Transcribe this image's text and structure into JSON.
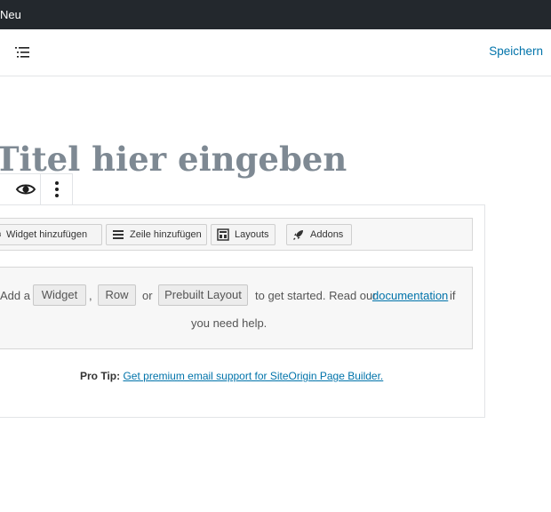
{
  "admin_bar": {
    "new_label": "Neu"
  },
  "header": {
    "save_label": "Speichern"
  },
  "title": {
    "placeholder": "Titel hier eingeben"
  },
  "pb_toolbar": {
    "widget": "Widget hinzufügen",
    "row": "Zeile hinzufügen",
    "layouts": "Layouts",
    "addons": "Addons"
  },
  "empty_state": {
    "add_a": "Add a",
    "widget_btn": "Widget",
    "comma": ",",
    "row_btn": "Row",
    "or": "or",
    "prebuilt_btn": "Prebuilt Layout",
    "to_get_started": "to get started. Read our",
    "documentation": "documentation",
    "if": "if",
    "you_need_help": "you need help."
  },
  "protip": {
    "label": "Pro Tip:",
    "link": "Get premium email support for SiteOrigin Page Builder."
  },
  "colors": {
    "admin_bar": "#23282d",
    "link": "#0073aa",
    "title": "#7e8993"
  }
}
